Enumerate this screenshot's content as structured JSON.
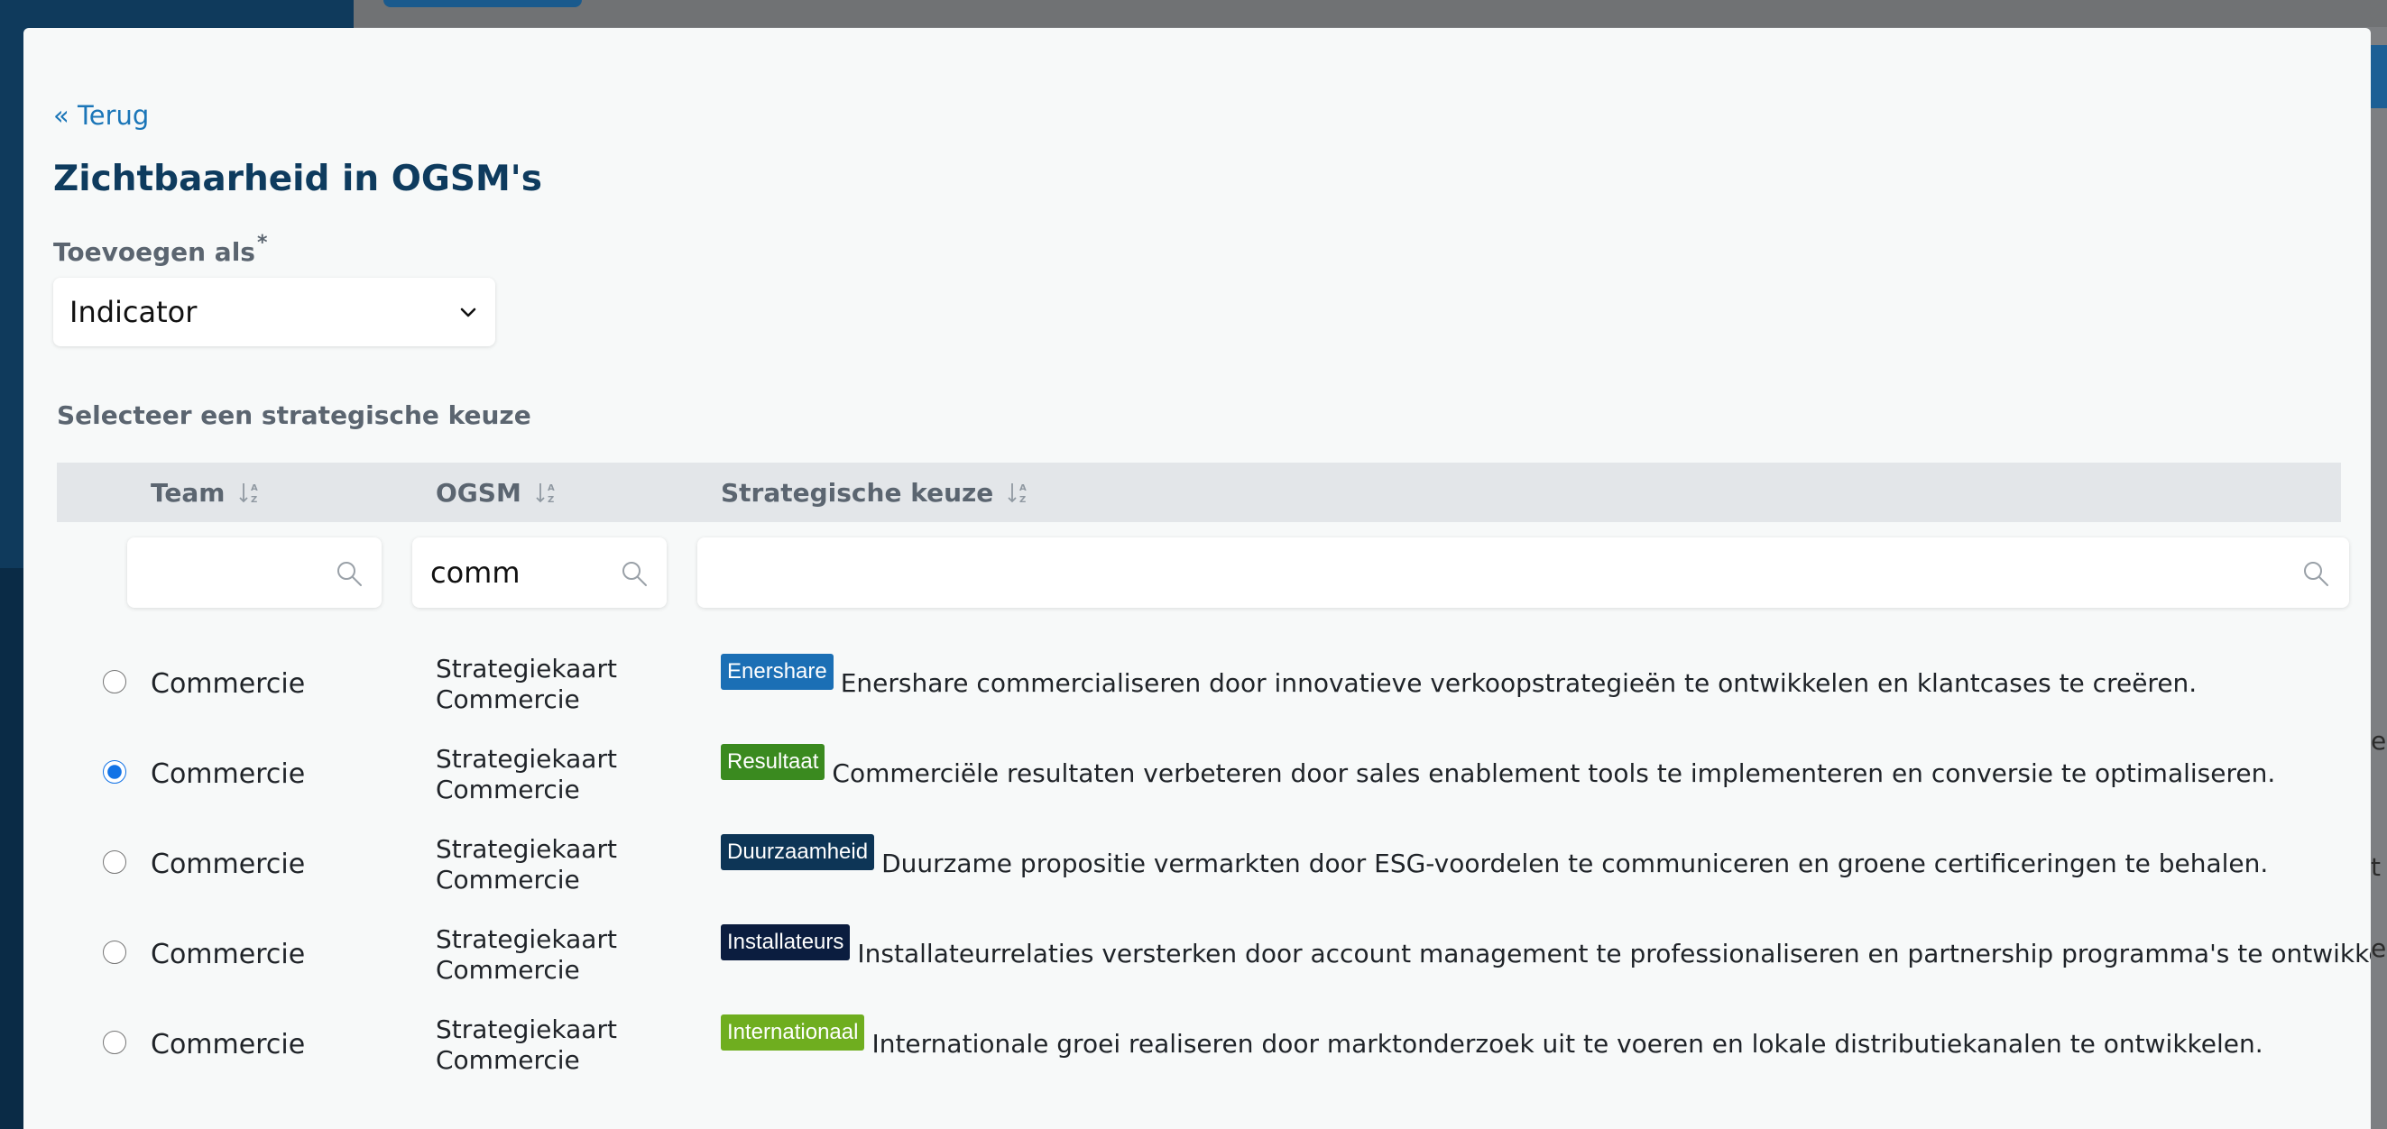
{
  "modal": {
    "back_label": "« Terug",
    "title": "Zichtbaarheid in OGSM's",
    "add_as": {
      "label": "Toevoegen als",
      "required_mark": "*",
      "selected": "Indicator"
    },
    "section_label": "Selecteer een strategische keuze"
  },
  "table": {
    "columns": [
      {
        "label": "Team",
        "filter_value": ""
      },
      {
        "label": "OGSM",
        "filter_value": "comm"
      },
      {
        "label": "Strategische keuze",
        "filter_value": ""
      }
    ],
    "rows": [
      {
        "selected": false,
        "team": "Commercie",
        "ogsm_line1": "Strategiekaart",
        "ogsm_line2": "Commercie",
        "tag": "Enershare",
        "tag_color": "#1b6fb5",
        "text": "Enershare commercialiseren door innovatieve verkoopstrategieën te ontwikkelen en klantcases te creëren."
      },
      {
        "selected": true,
        "team": "Commercie",
        "ogsm_line1": "Strategiekaart",
        "ogsm_line2": "Commercie",
        "tag": "Resultaat",
        "tag_color": "#3a8a1f",
        "text": "Commerciële resultaten verbeteren door sales enablement tools te implementeren en conversie te optimaliseren."
      },
      {
        "selected": false,
        "team": "Commercie",
        "ogsm_line1": "Strategiekaart",
        "ogsm_line2": "Commercie",
        "tag": "Duurzaamheid",
        "tag_color": "#0d3556",
        "text": "Duurzame propositie vermarkten door ESG-voordelen te communiceren en groene certificeringen te behalen."
      },
      {
        "selected": false,
        "team": "Commercie",
        "ogsm_line1": "Strategiekaart",
        "ogsm_line2": "Commercie",
        "tag": "Installateurs",
        "tag_color": "#0b1d3f",
        "text": "Installateurrelaties versterken door account management te professionaliseren en partnership programma's te ontwikkelen."
      },
      {
        "selected": false,
        "team": "Commercie",
        "ogsm_line1": "Strategiekaart",
        "ogsm_line2": "Commercie",
        "tag": "Internationaal",
        "tag_color": "#6fae1f",
        "text": "Internationale groei realiseren door marktonderzoek uit te voeren en lokale distributiekanalen te ontwikkelen."
      }
    ]
  },
  "background": {
    "edge_marks": [
      "e",
      "t",
      "e"
    ]
  },
  "colors": {
    "accent": "#1b76b8",
    "title": "#0e3b5e",
    "sidebar": "#0f3a5c"
  }
}
